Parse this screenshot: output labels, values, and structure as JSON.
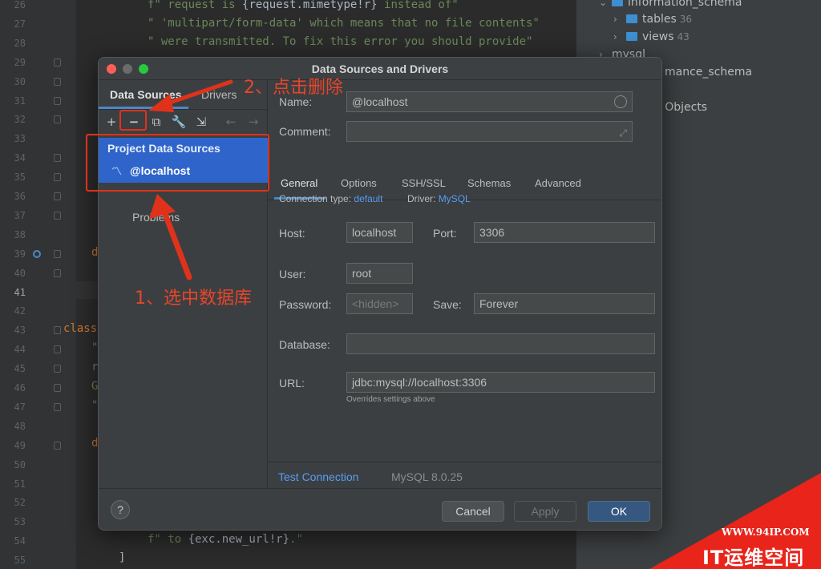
{
  "editor": {
    "line_numbers": [
      "26",
      "27",
      "28",
      "29",
      "30",
      "31",
      "32",
      "33",
      "34",
      "35",
      "36",
      "37",
      "38",
      "39",
      "40",
      "41",
      "42",
      "43",
      "44",
      "45",
      "46",
      "47",
      "48",
      "49",
      "50",
      "51",
      "52",
      "53",
      "54",
      "55"
    ],
    "current_line": "41",
    "code_line_26_prefix": "f\" request is ",
    "code_line_26_mid": "{request.mimetype!r}",
    "code_line_26_suffix": " instead of\"",
    "code_line_27": "\" 'multipart/form-data' which means that no file contents\"",
    "code_line_28": "\" were transmitted. To fix this error you should provide\"",
    "frag_39": "d",
    "frag_43": "class",
    "frag_44": "\"",
    "frag_45": "r",
    "frag_46": "G",
    "frag_47": "\"",
    "frag_49": "d",
    "code_line_54_prefix": "f\" to ",
    "code_line_54_mid": "{exc.new_url!r}",
    "code_line_54_suffix": ".\"",
    "code_line_55": "]"
  },
  "db_tree": {
    "schema": "information_schema",
    "tables_label": "tables",
    "tables_count": "36",
    "views_label": "views",
    "views_count": "43",
    "mysql_label": "mysql",
    "perf_schema_partial": "mance_schema",
    "server_objects_partial": "r Objects"
  },
  "dialog": {
    "title": "Data Sources and Drivers",
    "left_tabs": {
      "data_sources": "Data Sources",
      "drivers": "Drivers"
    },
    "group_label": "Project Data Sources",
    "selected_item": "@localhost",
    "problems": "Problems",
    "fields": {
      "name_label": "Name:",
      "name_value": "@localhost",
      "comment_label": "Comment:",
      "comment_value": ""
    },
    "tabs": [
      "General",
      "Options",
      "SSH/SSL",
      "Schemas",
      "Advanced"
    ],
    "connection_type_label": "Connection type:",
    "connection_type_value": "default",
    "driver_label": "Driver:",
    "driver_value": "MySQL",
    "host_label": "Host:",
    "host_value": "localhost",
    "port_label": "Port:",
    "port_value": "3306",
    "user_label": "User:",
    "user_value": "root",
    "password_label": "Password:",
    "password_placeholder": "<hidden>",
    "save_label": "Save:",
    "save_value": "Forever",
    "database_label": "Database:",
    "database_value": "",
    "url_label": "URL:",
    "url_value": "jdbc:mysql://localhost:3306",
    "url_hint": "Overrides settings above",
    "test_connection": "Test Connection",
    "server_version": "MySQL 8.0.25",
    "help": "?",
    "cancel": "Cancel",
    "apply": "Apply",
    "ok": "OK"
  },
  "annotations": {
    "step1": "1、选中数据库",
    "step2": "2、点击删除"
  },
  "watermark": {
    "url": "WWW.94IP.COM",
    "brand": "IT运维空间"
  },
  "colors": {
    "annotation_red": "#e8452b",
    "selection_blue": "#2f65ca",
    "link_blue": "#589df6",
    "ok_button": "#365880"
  }
}
